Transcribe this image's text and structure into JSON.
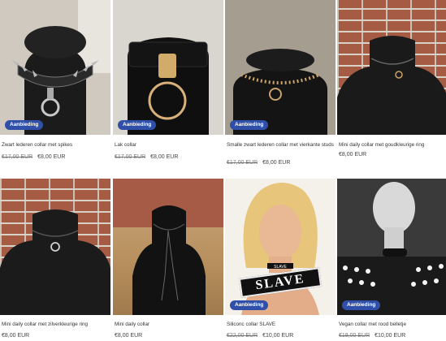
{
  "badge_label": "Aanbieding",
  "products": [
    {
      "title": "Zwart lederen collar met spikes",
      "old_price": "€17,00 EUR",
      "price": "€8,00 EUR",
      "badge": true
    },
    {
      "title": "Lak collar",
      "old_price": "€17,00 EUR",
      "price": "€8,00 EUR",
      "badge": true
    },
    {
      "title": "Smalle zwart lederen collar met vierkante studs",
      "old_price": "€17,00 EUR",
      "price": "€8,00 EUR",
      "badge": true
    },
    {
      "title": "Mini daily collar met goudkleurige ring",
      "old_price": "",
      "price": "€8,00 EUR",
      "badge": false
    },
    {
      "title": "Mini daily collar met zilverkleurige ring",
      "old_price": "",
      "price": "€8,00 EUR",
      "badge": false
    },
    {
      "title": "Mini daily collar",
      "old_price": "",
      "price": "€8,00 EUR",
      "badge": false
    },
    {
      "title": "Siliconc collar SLAVE",
      "old_price": "€22,00 EUR",
      "price": "€10,00 EUR",
      "badge": true
    },
    {
      "title": "Vegan collar met rood belletje",
      "old_price": "€19,00 EUR",
      "price": "€10,00 EUR",
      "badge": true
    }
  ],
  "slave_tag_text": "SLAVE",
  "colors": {
    "badge_bg": "#2f4fa8"
  }
}
